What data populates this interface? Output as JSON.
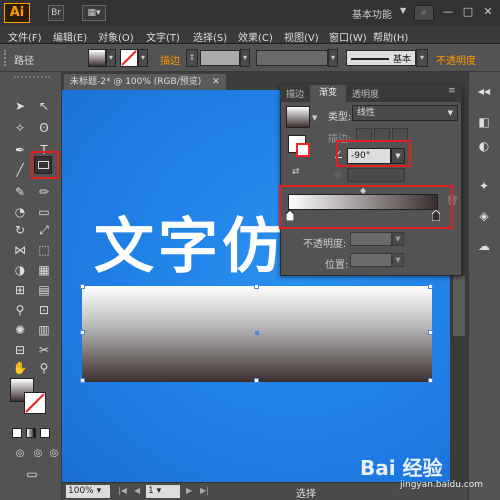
{
  "app": {
    "logo": "Ai",
    "workspace": "基本功能",
    "menu": [
      "文件(F)",
      "编辑(E)",
      "对象(O)",
      "文字(T)",
      "选择(S)",
      "效果(C)",
      "视图(V)",
      "窗口(W)",
      "帮助(H)"
    ]
  },
  "controlbar": {
    "object_type": "路径",
    "stroke_label": "描边",
    "style_label": "基本",
    "opacity_label": "不透明度"
  },
  "document": {
    "tab_title": "未标题-2* @ 100% (RGB/预览)",
    "canvas_text": "文字仿",
    "zoom": "100%",
    "page": "1",
    "status": "选择"
  },
  "gradient_panel": {
    "tabs": [
      "描边",
      "渐变",
      "透明度"
    ],
    "type_label": "类型:",
    "type_value": "线性",
    "stroke_label": "描边:",
    "angle_value": "-90°",
    "opacity_label": "不透明度:",
    "location_label": "位置:",
    "start_color": "#ffffff",
    "end_color": "#3b2f2e"
  },
  "watermark": {
    "brand": "Bai 经验",
    "url": "jingyan.baidu.com"
  },
  "colors": {
    "canvas_bg": "#1f7fe6",
    "highlight": "#e02020",
    "accent": "#ff9a00"
  }
}
